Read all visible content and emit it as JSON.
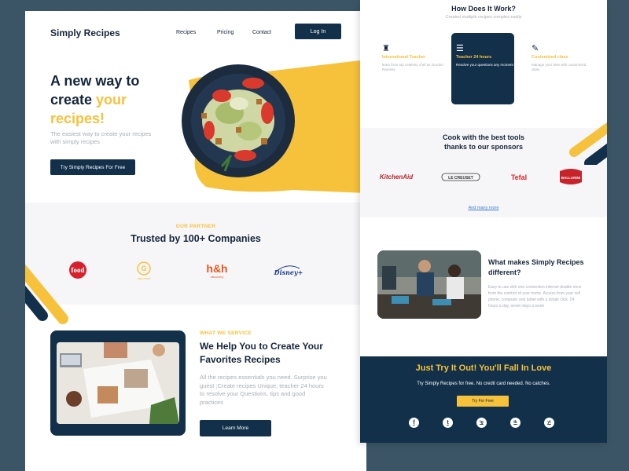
{
  "header": {
    "logo": "Simply Recipes",
    "nav": [
      "Recipes",
      "Pricing",
      "Contact"
    ],
    "login_label": "Log In"
  },
  "hero": {
    "title_line1": "A new way to",
    "title_line2": "create ",
    "title_accent_1": "your",
    "title_accent_2": "recipes!",
    "subtitle": "The easiest way to create your recipes with simply recipes",
    "cta_label": "Try Simply Recipes For Free"
  },
  "partners": {
    "eyebrow": "OUR PARTNER",
    "title": "Trusted by 100+ Companies",
    "logos": [
      {
        "name": "food",
        "sub": "network"
      },
      {
        "name": "G",
        "sub": "dgourmet"
      },
      {
        "name": "h&h",
        "sub": "discovery"
      },
      {
        "name": "Disney+",
        "sub": ""
      }
    ]
  },
  "service": {
    "eyebrow": "WHAT WE SERVICE",
    "title": "We Help You to Create Your Favorites Recipes",
    "text": "All the recipes essentials you need. Surprise you guest ;Create recipes Unique, teacher 24 hours to resolve your Questions, tips and good practices",
    "button_label": "Learn More"
  },
  "how": {
    "title": "How Does It Work?",
    "subtitle": "Created multiple recipes complex easily",
    "features": [
      {
        "icon": "chef-hat-icon",
        "title": "International Teacher",
        "desc": "learn from top celebrity chef as Gordon Ramsey"
      },
      {
        "icon": "utensils-icon",
        "title": "Teacher 24 hours",
        "desc": "Resolve your questions any moment"
      },
      {
        "icon": "chat-icon",
        "title": "Customized class",
        "desc": "Manage your time with customized class"
      }
    ]
  },
  "sponsors": {
    "title_line1": "Cook with the best tools",
    "title_line2": "thanks to our sponsors",
    "logos": [
      "KitchenAid",
      "LE CREUSET",
      "Tefal",
      "BALLARINI"
    ],
    "more_link": "And many more"
  },
  "different": {
    "title": "What makes Simply Recipes different?",
    "text": "Easy to use with one connection internet double once from the comfort of your home. Access from your cell phone, computer and tablet with a single click. 24 hours a day, seven days a week"
  },
  "cta": {
    "title": "Just Try It Out! You'll Fall In Love",
    "subtitle": "Try Simply Recipes for free. No credit card needed. No catches.",
    "button_label": "Try For Free",
    "social": [
      "f",
      "t",
      "ig",
      "tk",
      "yt"
    ]
  },
  "colors": {
    "navy": "#123049",
    "accent": "#f6c13b",
    "text": "#16253a",
    "muted": "#a8adb3",
    "band": "#f6f6f8",
    "backdrop": "#3b5566"
  }
}
